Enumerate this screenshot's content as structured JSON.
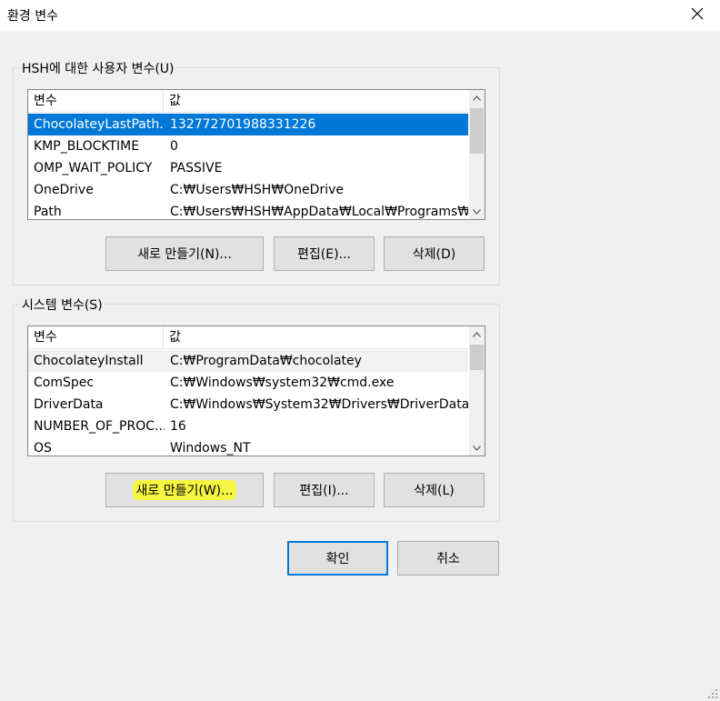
{
  "window": {
    "title": "환경 변수"
  },
  "user_vars": {
    "label": "HSH에 대한 사용자 변수(U)",
    "col_name": "변수",
    "col_value": "값",
    "rows": [
      {
        "name": "ChocolateyLastPath...",
        "value": "132772701988331226"
      },
      {
        "name": "KMP_BLOCKTIME",
        "value": "0"
      },
      {
        "name": "OMP_WAIT_POLICY",
        "value": "PASSIVE"
      },
      {
        "name": "OneDrive",
        "value": "C:₩Users₩HSH₩OneDrive"
      },
      {
        "name": "Path",
        "value": "C:₩Users₩HSH₩AppData₩Local₩Programs₩..."
      }
    ],
    "new_label": "새로 만들기(N)...",
    "edit_label": "편집(E)...",
    "delete_label": "삭제(D)"
  },
  "system_vars": {
    "label": "시스템 변수(S)",
    "col_name": "변수",
    "col_value": "값",
    "rows": [
      {
        "name": "ChocolateyInstall",
        "value": "C:₩ProgramData₩chocolatey"
      },
      {
        "name": "ComSpec",
        "value": "C:₩Windows₩system32₩cmd.exe"
      },
      {
        "name": "DriverData",
        "value": "C:₩Windows₩System32₩Drivers₩DriverData"
      },
      {
        "name": "NUMBER_OF_PROC...",
        "value": "16"
      },
      {
        "name": "OS",
        "value": "Windows_NT"
      }
    ],
    "new_label": "새로 만들기(W)...",
    "edit_label": "편집(I)...",
    "delete_label": "삭제(L)"
  },
  "footer": {
    "ok_label": "확인",
    "cancel_label": "취소"
  },
  "colors": {
    "selection": "#0078d7",
    "highlight": "#f5f542"
  }
}
